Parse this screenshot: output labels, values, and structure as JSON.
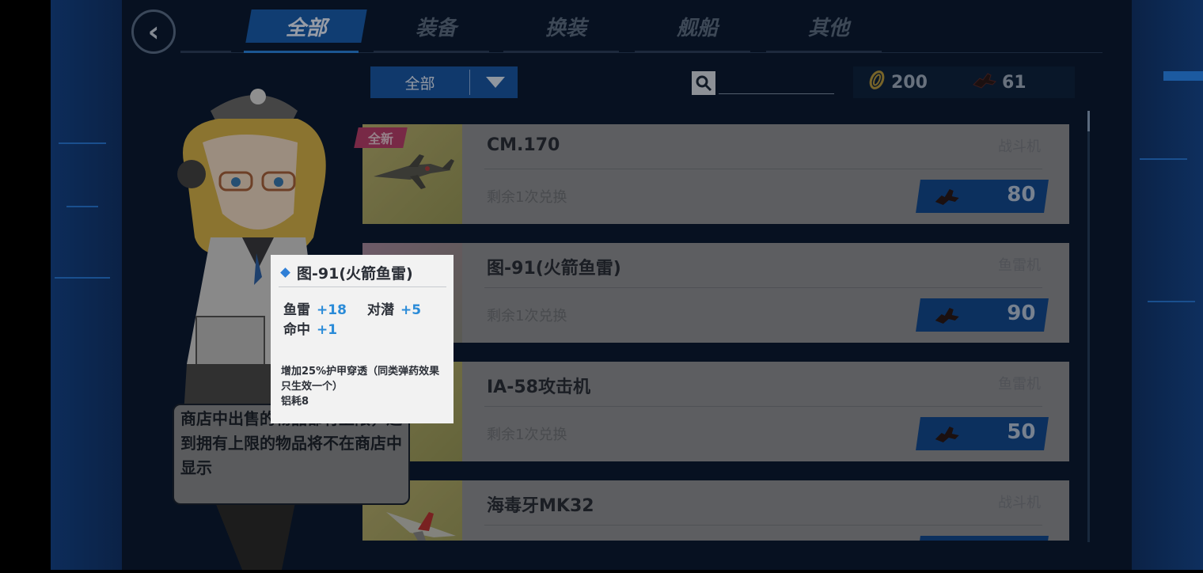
{
  "tabs": [
    {
      "label": "全部",
      "active": true
    },
    {
      "label": "装备",
      "active": false
    },
    {
      "label": "换装",
      "active": false
    },
    {
      "label": "舰船",
      "active": false
    },
    {
      "label": "其他",
      "active": false
    }
  ],
  "filter": {
    "selected": "全部"
  },
  "search": {
    "value": ""
  },
  "currency": {
    "coins": "200",
    "tokens": "61"
  },
  "items": [
    {
      "name": "CM.170",
      "type": "战斗机",
      "remain": "剩余1次兑换",
      "price": "80",
      "badge": "全新"
    },
    {
      "name": "图-91(火箭鱼雷)",
      "type": "鱼雷机",
      "remain": "剩余1次兑换",
      "price": "90"
    },
    {
      "name": "IA-58攻击机",
      "type": "鱼雷机",
      "remain": "剩余1次兑换",
      "price": "50"
    },
    {
      "name": "海毒牙MK32",
      "type": "战斗机"
    }
  ],
  "bubble": {
    "text": "商店中出售的物品都有上限，达到拥有上限的物品将不在商店中显示"
  },
  "tooltip": {
    "title": "图-91(火箭鱼雷)",
    "stats": [
      {
        "label": "鱼雷",
        "value": "+18"
      },
      {
        "label": "对潜",
        "value": "+5"
      },
      {
        "label": "命中",
        "value": "+1"
      }
    ],
    "desc": "增加25%护甲穿透（同类弹药效果只生效一个）",
    "cost": "铝耗8"
  },
  "colors": {
    "accent": "#1a5fb0",
    "stat": "#2a8bd8",
    "badge": "#b8406c"
  }
}
